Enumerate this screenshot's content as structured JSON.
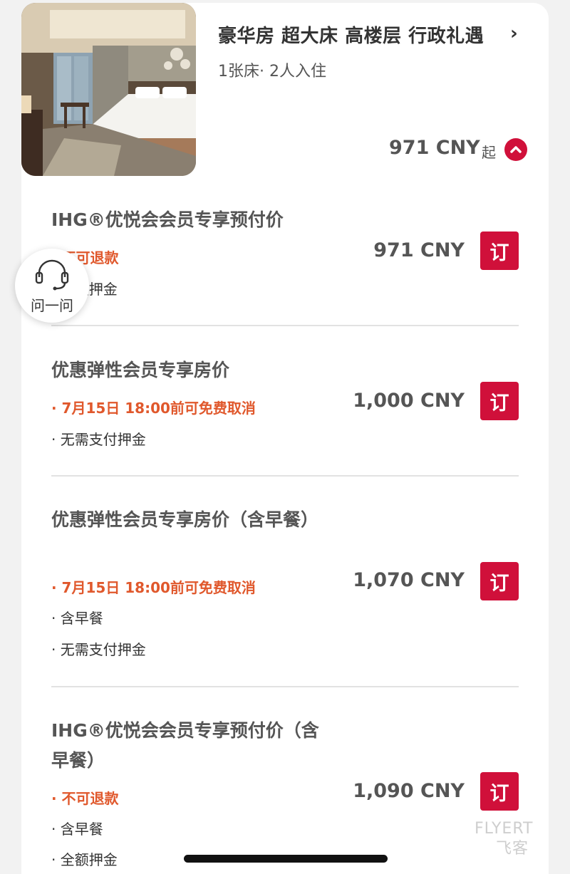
{
  "room": {
    "title": "豪华房 超大床 高楼层 行政礼遇",
    "chevron": "›",
    "subtitle": "1张床· 2人入住",
    "price": "971 CNY",
    "price_suffix": "起"
  },
  "rates": [
    {
      "name": "IHG®优悦会会员专享预付价",
      "policies": [
        {
          "text": "· 不可退款",
          "style": "red"
        },
        {
          "text": "· 全额押金",
          "style": "dark"
        }
      ],
      "price": "971 CNY",
      "book_label": "订"
    },
    {
      "name": "优惠弹性会员专享房价",
      "policies": [
        {
          "text": "· 7月15日 18:00前可免费取消",
          "style": "red"
        },
        {
          "text": "· 无需支付押金",
          "style": "dark"
        }
      ],
      "price": "1,000 CNY",
      "book_label": "订"
    },
    {
      "name": "优惠弹性会员专享房价（含早餐）",
      "policies": [
        {
          "text": "· 7月15日 18:00前可免费取消",
          "style": "red"
        },
        {
          "text": "· 含早餐",
          "style": "dark"
        },
        {
          "text": "· 无需支付押金",
          "style": "dark"
        }
      ],
      "price": "1,070 CNY",
      "book_label": "订"
    },
    {
      "name": "IHG®优悦会会员专享预付价（含早餐）",
      "policies": [
        {
          "text": "· 不可退款",
          "style": "red"
        },
        {
          "text": "· 含早餐",
          "style": "dark"
        },
        {
          "text": "· 全额押金",
          "style": "dark"
        }
      ],
      "price": "1,090 CNY",
      "book_label": "订"
    }
  ],
  "help": {
    "label": "问一问",
    "icon": "headset-icon"
  },
  "watermark": {
    "line1": "FLYERT",
    "line2": "飞客"
  },
  "colors": {
    "accent": "#d0103a",
    "policy_red": "#e0582c",
    "text_gray": "#555555"
  }
}
